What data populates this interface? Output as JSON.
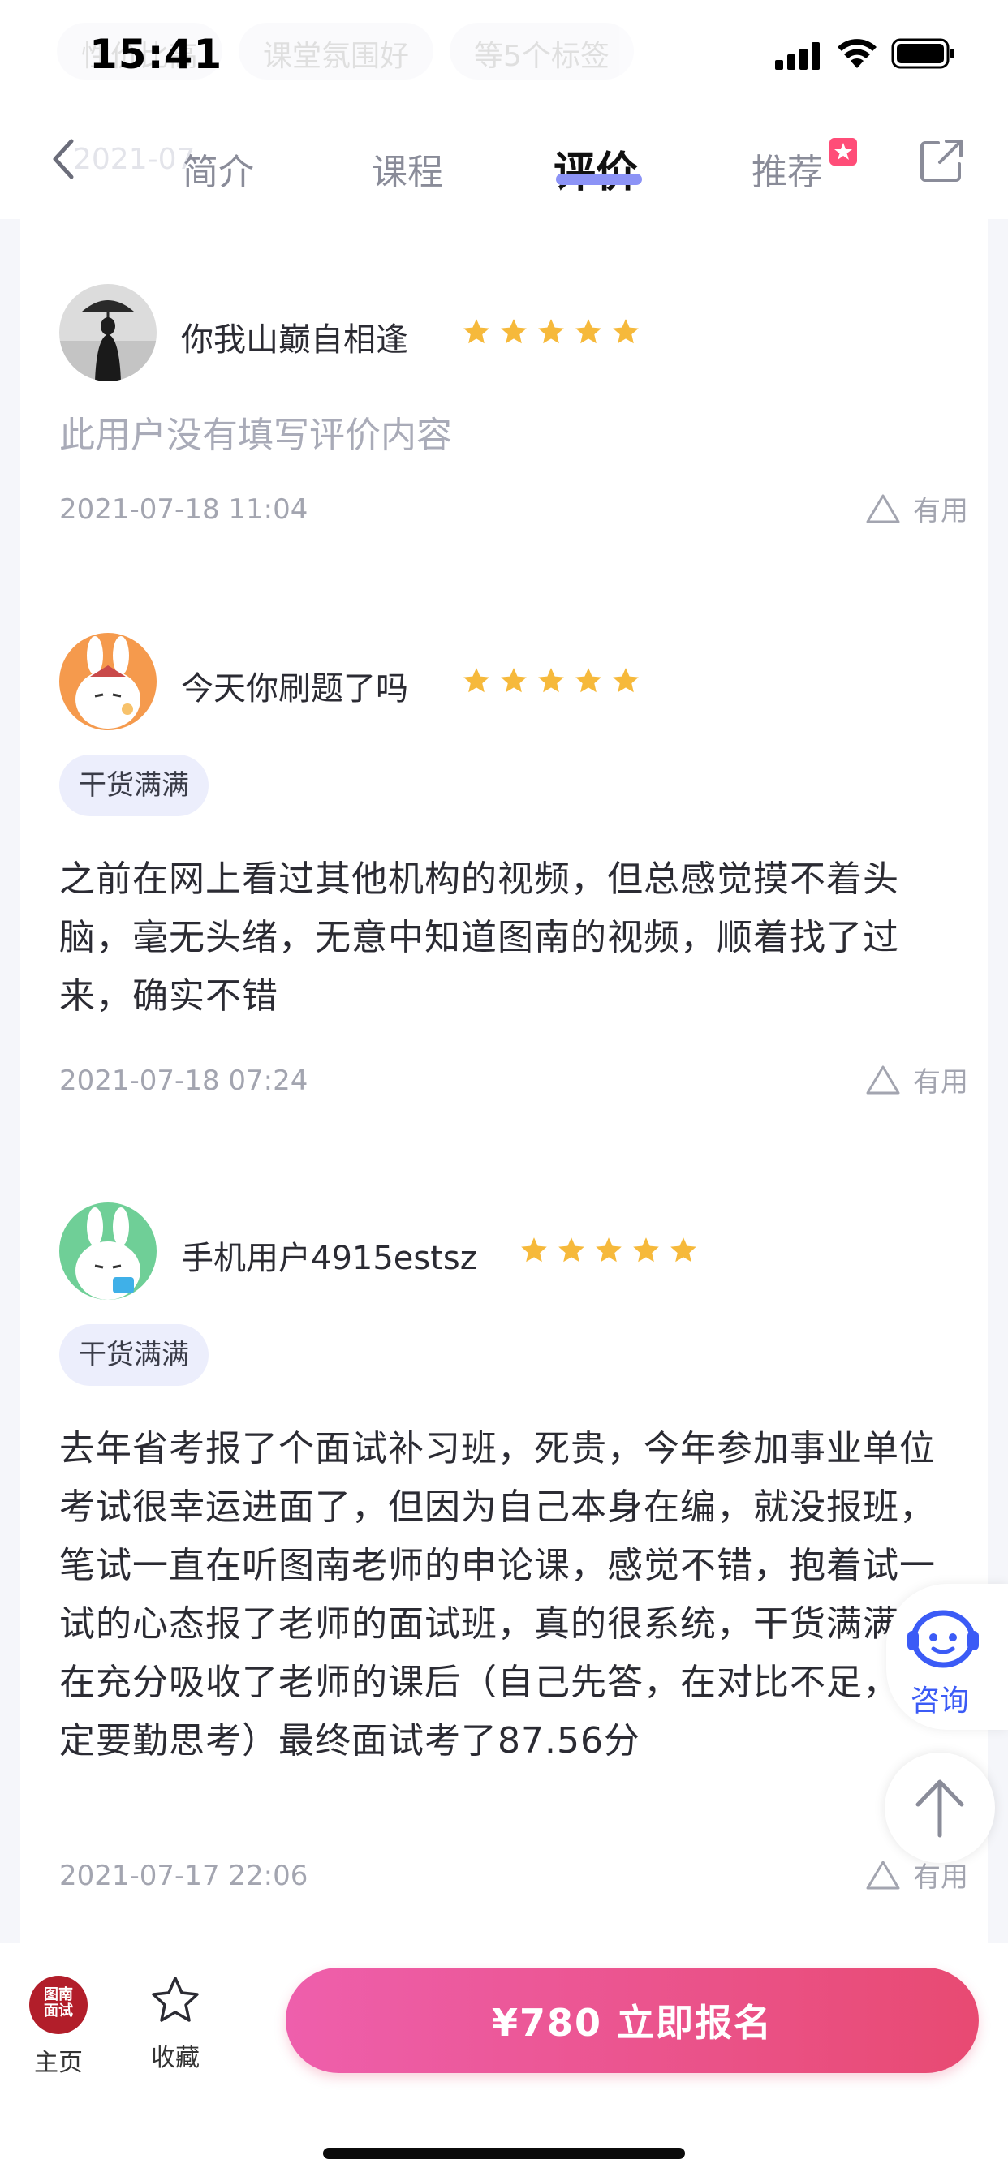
{
  "status_bar": {
    "time": "15:41",
    "ghost_tags": [
      "性价比高",
      "课堂氛围好",
      "等5个标签"
    ]
  },
  "nav": {
    "ghost_date": "2021-07",
    "tabs": [
      {
        "label": "简介"
      },
      {
        "label": "课程"
      },
      {
        "label": "评价"
      },
      {
        "label": "推荐"
      }
    ],
    "active_tab": "评价"
  },
  "reviews": [
    {
      "username": "你我山巅自相逢",
      "rating": 5,
      "content_placeholder": "此用户没有填写评价内容",
      "date": "2021-07-18 11:04",
      "helpful_label": "有用"
    },
    {
      "username": "今天你刷题了吗",
      "rating": 5,
      "tag": "干货满满",
      "content": "之前在网上看过其他机构的视频，但总感觉摸不着头脑，毫无头绪，无意中知道图南的视频，顺着找了过来，确实不错",
      "date": "2021-07-18 07:24",
      "helpful_label": "有用"
    },
    {
      "username": "手机用户4915estsz",
      "rating": 5,
      "tag": "干货满满",
      "content": "去年省考报了个面试补习班，死贵，今年参加事业单位考试很幸运进面了，但因为自己本身在编，就没报班，笔试一直在听图南老师的申论课，感觉不错，抱着试一试的心态报了老师的面试班，真的很系统，干货满满，在充分吸收了老师的课后（自己先答，在对比不足，一定要勤思考）最终面试考了87.56分",
      "date": "2021-07-17 22:06",
      "helpful_label": "有用"
    }
  ],
  "floating": {
    "consult_label": "咨询"
  },
  "bottom_bar": {
    "home_logo": "图南\n面试",
    "home_label": "主页",
    "favorite_label": "收藏",
    "enroll_label": "¥780  立即报名"
  },
  "colors": {
    "accent_blue": "#3b5bf6",
    "tab_underline": "#8c93f6",
    "star": "#f6b93b",
    "enroll_start": "#ee5fac",
    "enroll_end": "#e84a72"
  }
}
